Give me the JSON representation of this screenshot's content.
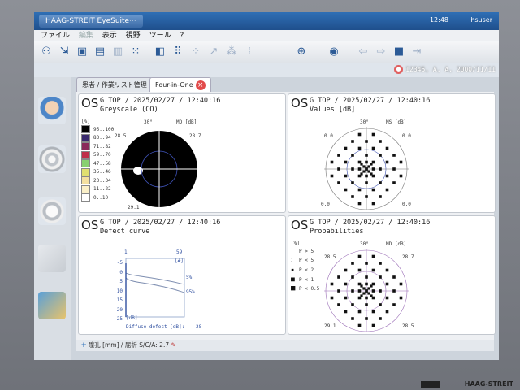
{
  "app": {
    "window_title": "HAAG-STREIT EyeSuite···",
    "clock": "12:48",
    "user": "hsuser",
    "brand": "HAAG-STREIT"
  },
  "menu": [
    "ファイル",
    "編集",
    "表示",
    "視野",
    "ツール",
    "?"
  ],
  "patient_info": "12345, A, A, 2000/11/11",
  "tabs": [
    "患者 / 作業リスト管理",
    "Four-in-One"
  ],
  "panels": {
    "greyscale": {
      "eye": "OS",
      "header": "G TOP / 2025/02/27 / 12:40:16",
      "subtitle": "Greyscale (CO)",
      "angle_label": "30°",
      "md_label": "MD [dB]",
      "val_left": "28.5",
      "val_right": "28.7",
      "val_bottom_left": "29.1",
      "legend_unit": "[%]",
      "legend": [
        {
          "label": "95..100",
          "color": "#000000"
        },
        {
          "label": "83..94",
          "color": "#3a2a6e"
        },
        {
          "label": "71..82",
          "color": "#8a2a5a"
        },
        {
          "label": "59..70",
          "color": "#c0304a"
        },
        {
          "label": "47..58",
          "color": "#88d070"
        },
        {
          "label": "35..46",
          "color": "#e0e070"
        },
        {
          "label": "23..34",
          "color": "#f4e0a0"
        },
        {
          "label": "11..22",
          "color": "#fbf0c8"
        },
        {
          "label": "0..10",
          "color": "#ffffff"
        }
      ]
    },
    "values": {
      "eye": "OS",
      "header": "G TOP / 2025/02/27 / 12:40:16",
      "subtitle": "Values  [dB]",
      "angle_label": "30°",
      "ms_label": "MS [dB]",
      "val_top_left": "0.0",
      "val_top_right": "0.0",
      "val_bottom_left": "0.0",
      "val_bottom_right": "0.0"
    },
    "defect": {
      "eye": "OS",
      "header": "G TOP / 2025/02/27 / 12:40:16",
      "subtitle": "Defect curve",
      "top_left": "1",
      "top_right": "59",
      "hash_label": "[#]",
      "y_ticks": [
        "-5",
        "0",
        "5",
        "10",
        "15",
        "20",
        "25"
      ],
      "y_unit": "[dB]",
      "pct5": "5%",
      "pct95": "95%",
      "diffuse_label": "Diffuse defect [dB]:",
      "diffuse_value": "28"
    },
    "prob": {
      "eye": "OS",
      "header": "G TOP / 2025/02/27 / 12:40:16",
      "subtitle": "Probabilities",
      "angle_label": "30°",
      "md_label": "MD [dB]",
      "legend_unit": "[%]",
      "legend": [
        "P > 5",
        "P < 5",
        "P < 2",
        "P < 1",
        "P < 0.5"
      ],
      "val_left": "28.5",
      "val_right": "28.7",
      "val_bottom_left": "29.1",
      "val_bottom_right": "28.5"
    }
  },
  "status_text": "瞳孔 [mm] / 屈折 S/C/A: 2.7",
  "icons": [
    "patient-icon",
    "open-icon",
    "save-icon",
    "print-icon",
    "eye-icon",
    "zoom-icon",
    "back-arrow-icon",
    "forward-arrow-icon",
    "stop-icon",
    "close-icon"
  ]
}
